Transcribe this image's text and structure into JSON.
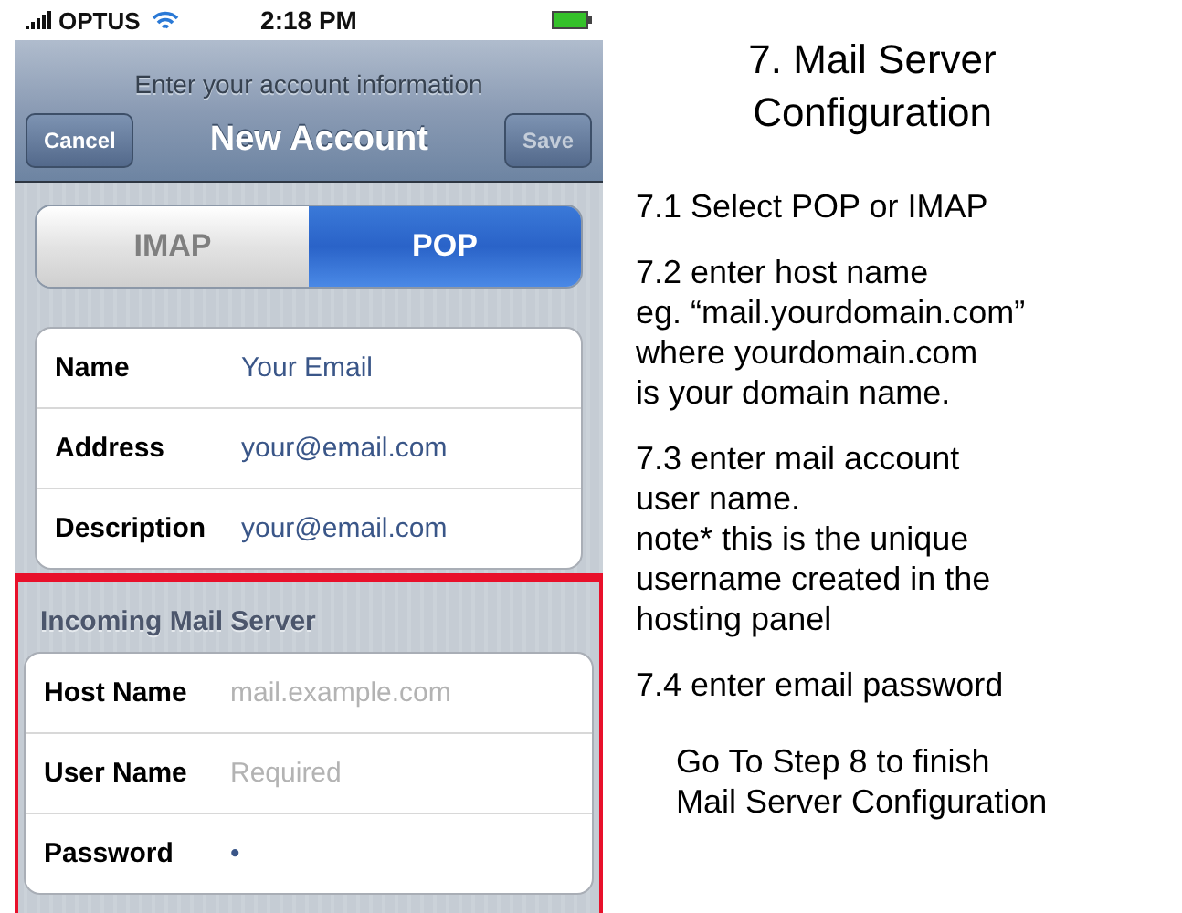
{
  "status_bar": {
    "carrier": "OPTUS",
    "time": "2:18 PM"
  },
  "nav": {
    "prompt": "Enter your account information",
    "title": "New Account",
    "left_button": "Cancel",
    "right_button": "Save"
  },
  "segments": [
    {
      "label": "IMAP",
      "selected": false
    },
    {
      "label": "POP",
      "selected": true
    }
  ],
  "account_fields": [
    {
      "label": "Name",
      "value": "Your Email"
    },
    {
      "label": "Address",
      "value": "your@email.com"
    },
    {
      "label": "Description",
      "value": "your@email.com"
    }
  ],
  "incoming_server": {
    "header": "Incoming Mail Server",
    "highlighted": true,
    "fields": [
      {
        "label": "Host Name",
        "placeholder": "mail.example.com"
      },
      {
        "label": "User Name",
        "placeholder": "Required"
      },
      {
        "label": "Password",
        "value": "•"
      }
    ]
  },
  "instructions": {
    "title": [
      "7. Mail Server",
      "Configuration"
    ],
    "steps": [
      {
        "lines": [
          "7.1 Select POP or IMAP"
        ]
      },
      {
        "lines": [
          "7.2 enter host name",
          "eg. “mail.yourdomain.com”",
          "where yourdomain.com",
          "is your domain name."
        ]
      },
      {
        "lines": [
          "7.3 enter mail account",
          "user name.",
          "note* this is the unique",
          "username created in the",
          "hosting panel"
        ]
      },
      {
        "lines": [
          "7.4 enter email password"
        ]
      }
    ],
    "footer": [
      "Go To Step 8 to finish",
      "Mail Server Configuration"
    ]
  }
}
